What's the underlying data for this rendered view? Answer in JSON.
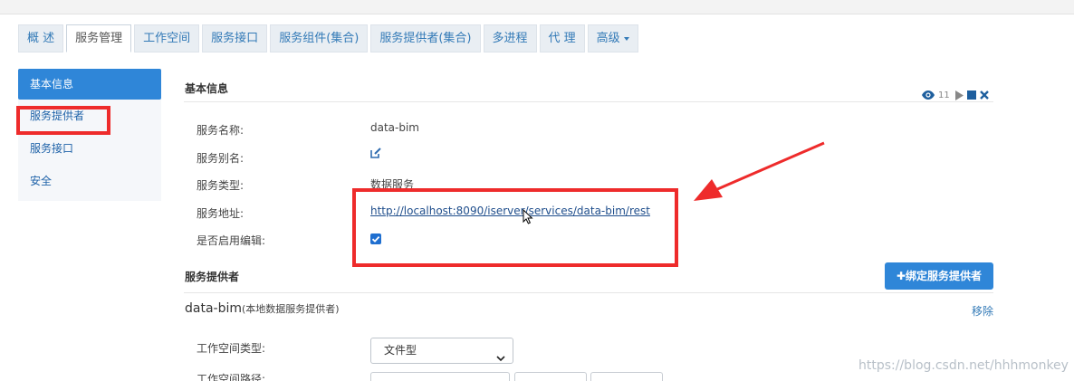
{
  "tabs": [
    "概 述",
    "服务管理",
    "工作空间",
    "服务接口",
    "服务组件(集合)",
    "服务提供者(集合)",
    "多进程",
    "代 理",
    "高级"
  ],
  "sidebar": {
    "items": [
      "基本信息",
      "服务提供者",
      "服务接口",
      "安全"
    ]
  },
  "basic_info": {
    "title": "基本信息",
    "view_count": "11",
    "fields": {
      "service_name_label": "服务名称:",
      "service_name_value": "data-bim",
      "service_alias_label": "服务别名:",
      "service_type_label": "服务类型:",
      "service_type_value": "数据服务",
      "service_address_label": "服务地址:",
      "service_address_value": "http://localhost:8090/iserver/services/data-bim/rest",
      "edit_enabled_label": "是否启用编辑:"
    }
  },
  "providers": {
    "title": "服务提供者",
    "bind_button": "✚绑定服务提供者",
    "name": "data-bim",
    "subtitle": "(本地数据服务提供者)",
    "remove_label": "移除",
    "workspace_type_label": "工作空间类型:",
    "workspace_type_value": "文件型",
    "workspace_path_label": "工作空间路径:"
  },
  "watermark": "https://blog.csdn.net/hhhmonkey",
  "colors": {
    "accent": "#2f86d8",
    "link": "#1f4e8c",
    "highlight_red": "#ee2b2b"
  }
}
